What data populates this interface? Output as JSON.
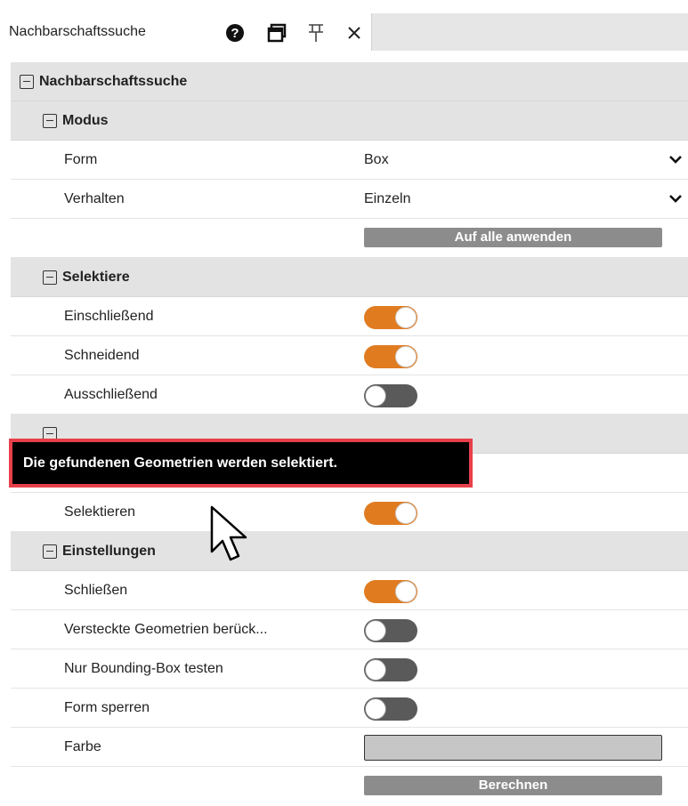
{
  "tab": {
    "title": "Nachbarschaftssuche",
    "icons": [
      "help-icon",
      "window-icon",
      "pin-icon",
      "close-icon"
    ]
  },
  "panel": {
    "root_title": "Nachbarschaftssuche",
    "modus": {
      "title": "Modus",
      "form_label": "Form",
      "form_value": "Box",
      "verhalten_label": "Verhalten",
      "verhalten_value": "Einzeln",
      "apply_button": "Auf alle anwenden"
    },
    "selektiere": {
      "title": "Selektiere",
      "items": [
        {
          "label": "Einschließend",
          "on": true
        },
        {
          "label": "Schneidend",
          "on": true
        },
        {
          "label": "Ausschließend",
          "on": false
        }
      ]
    },
    "hidden_section": {
      "items": [
        {
          "label": "Selektieren",
          "on": true
        }
      ]
    },
    "einstellungen": {
      "title": "Einstellungen",
      "items": [
        {
          "label": "Schließen",
          "on": true
        },
        {
          "label": "Versteckte Geometrien berück...",
          "on": false
        },
        {
          "label": "Nur Bounding-Box testen",
          "on": false
        },
        {
          "label": "Form sperren",
          "on": false
        }
      ],
      "farbe_label": "Farbe",
      "farbe_color": "#c6c6c6",
      "calc_button": "Berechnen"
    }
  },
  "tooltip": {
    "text": "Die gefundenen Geometrien werden selektiert."
  },
  "colors": {
    "accent": "#e07b20",
    "toggle_off": "#5a5a5a",
    "section_bg": "#e3e3e3",
    "button_bg": "#8c8c8c",
    "tooltip_border": "#e8404a"
  }
}
